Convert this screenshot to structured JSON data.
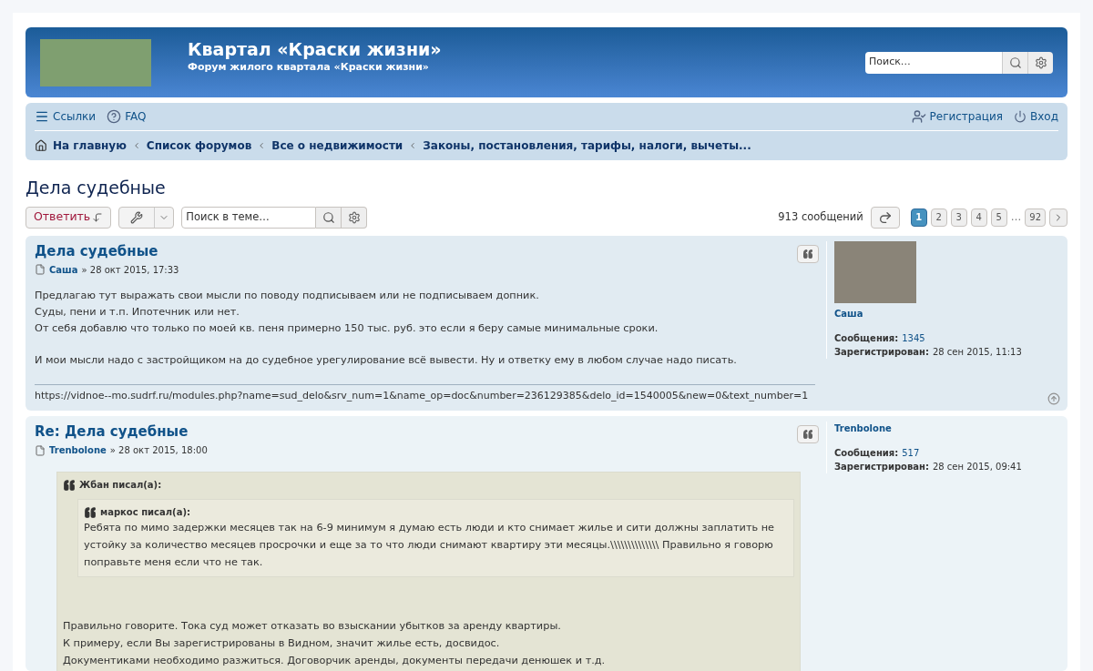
{
  "header": {
    "title": "Квартал «Краски жизни»",
    "subtitle": "Форум жилого квартала «Краски жизни»",
    "search_placeholder": "Поиск…"
  },
  "navbar": {
    "left_links": [
      {
        "label": "Ссылки",
        "kind": "menu"
      },
      {
        "label": "FAQ",
        "kind": "faq"
      }
    ],
    "right_links": [
      {
        "label": "Регистрация",
        "kind": "register"
      },
      {
        "label": "Вход",
        "kind": "login"
      }
    ],
    "breadcrumbs": [
      "На главную",
      "Список форумов",
      "Все о недвижимости",
      "Законы, постановления, тарифы, налоги, вычеты..."
    ]
  },
  "topic_title": "Дела судебные",
  "toolbar": {
    "reply_label": "Ответить",
    "search_placeholder": "Поиск в теме…",
    "post_count": "913 сообщений",
    "pages": [
      {
        "label": "1",
        "selected": true
      },
      {
        "label": "2",
        "selected": false
      },
      {
        "label": "3",
        "selected": false
      },
      {
        "label": "4",
        "selected": false
      },
      {
        "label": "5",
        "selected": false
      },
      {
        "label": "…",
        "kind": "ellipsis"
      },
      {
        "label": "92",
        "selected": false
      }
    ]
  },
  "posts": [
    {
      "title": "Дела судебные",
      "author": "Саша",
      "date": "» 28 окт 2015, 17:33",
      "avatar": true,
      "back_to_top": true,
      "paragraphs": [
        [
          "Предлагаю тут выражать свои мысли по поводу подписываем или не подписываем допник.",
          "Суды, пени и т.п. Ипотечник или нет.",
          "От себя добавлю что только по моей кв. пеня примерно 150 тыс. руб. это если я беру самые минимальные сроки."
        ],
        [
          "И мои мысли надо с застройщиком на до судебное урегулирование всё вывести. Ну и ответку ему в любом случае надо писать."
        ]
      ],
      "signature": "https://vidnoe--mo.sudrf.ru/modules.php?name=sud_delo&srv_num=1&name_op=doc&number=236129385&delo_id=1540005&new=0&text_number=1",
      "profile": {
        "name": "Саша",
        "posts_label": "Сообщения:",
        "posts": "1345",
        "registered_label": "Зарегистрирован:",
        "registered": "28 сен 2015, 11:13"
      }
    },
    {
      "title": "Re: Дела судебные",
      "author": "Trenbolone",
      "date": "» 28 окт 2015, 18:00",
      "avatar": false,
      "back_to_top": false,
      "quote": {
        "cite": "Жбан писал(а):",
        "quote": {
          "cite": "маркос писал(а):",
          "lines": [
            "Ребята по мимо задержки месяцев так на 6-9 минимум я думаю есть люди и кто снимает жилье и сити должны заплатить не устойку за количество месяцев просрочки и еще за то что люди снимают квартиру эти месяцы.\\\\\\\\\\\\\\\\\\\\\\\\\\\\ Правильно я говорю поправьте меня если что не так."
          ]
        },
        "lines": [
          "Правильно говорите. Тока суд может отказать во взыскании убытков за аренду квартиры.",
          "К примеру, если Вы зарегистрированы в Видном, значит жилье есть, досвидос.",
          "Документиками необходимо разжиться. Договорчик аренды, документы передачи денюшек и т.д."
        ]
      },
      "profile": {
        "name": "Trenbolone",
        "posts_label": "Сообщения:",
        "posts": "517",
        "registered_label": "Зарегистрирован:",
        "registered": "28 сен 2015, 09:41"
      }
    }
  ]
}
